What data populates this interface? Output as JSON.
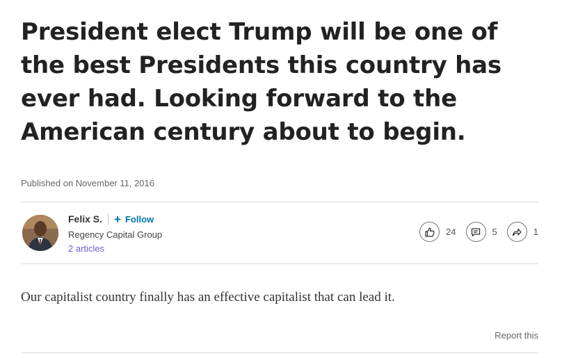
{
  "article": {
    "title": "President elect Trump will be one of the best Presidents this country has ever had. Looking forward to the American century about to begin.",
    "published": "Published on November 11, 2016",
    "body": "Our capitalist country finally has an effective capitalist that can lead it.",
    "report_label": "Report this"
  },
  "author": {
    "name": "Felix S.",
    "follow_label": "Follow",
    "company": "Regency Capital Group",
    "articles_label": "2 articles"
  },
  "stats": {
    "likes": "24",
    "comments": "5",
    "shares": "1"
  },
  "icons": {
    "follow": "plus-icon",
    "like": "thumbs-up-icon",
    "comment": "comment-icon",
    "share": "share-arrow-icon"
  },
  "colors": {
    "link_blue": "#0073b1",
    "articles_purple": "#6f5bd6",
    "divider": "#d9d9d9"
  }
}
